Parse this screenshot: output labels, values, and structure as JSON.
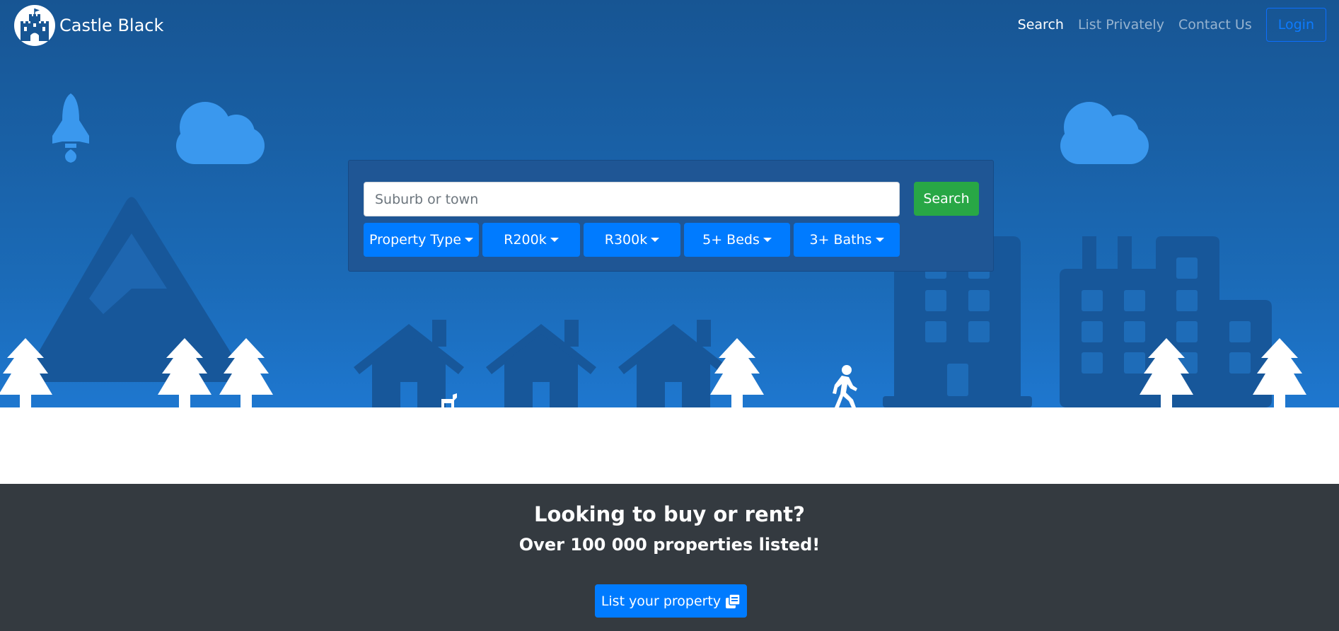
{
  "brand": {
    "name": "Castle Black",
    "logo_icon": "castle-icon"
  },
  "nav": {
    "links": [
      {
        "label": "Search",
        "active": true
      },
      {
        "label": "List Privately",
        "active": false
      },
      {
        "label": "Contact Us",
        "active": false
      }
    ],
    "login_label": "Login"
  },
  "search": {
    "placeholder": "Suburb or town",
    "button_label": "Search",
    "filters": [
      {
        "label": "Property Type"
      },
      {
        "label": "R200k"
      },
      {
        "label": "R300k"
      },
      {
        "label": "5+ Beds"
      },
      {
        "label": "3+ Baths"
      }
    ]
  },
  "cta": {
    "title": "Looking to buy or rent?",
    "subtitle": "Over 100 000 properties listed!",
    "button_label": "List your property",
    "button_icon": "copy-icon"
  },
  "colors": {
    "hero_top": "#175593",
    "hero_bottom": "#1e77cf",
    "primary": "#007bff",
    "success": "#28a745",
    "dark": "#343a40",
    "silhouette": "#17579a",
    "cloud": "#3a98ee"
  }
}
